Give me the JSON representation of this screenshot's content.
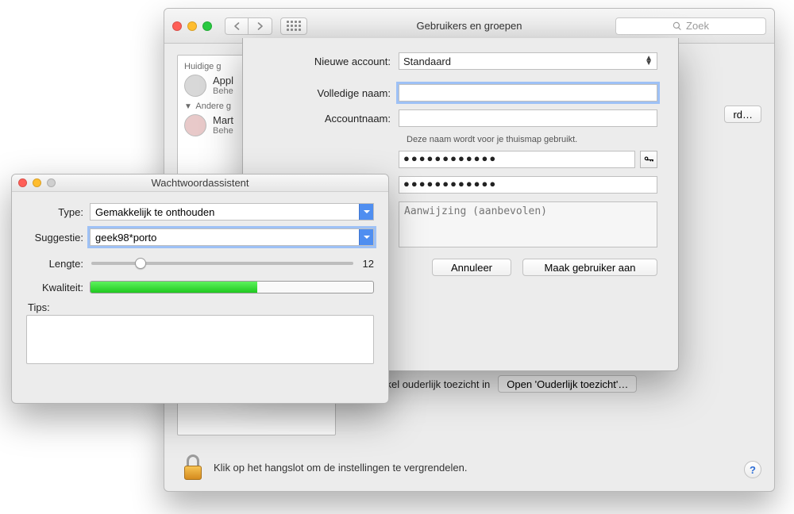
{
  "pref": {
    "title": "Gebruikers en groepen",
    "search_placeholder": "Zoek",
    "sidebar": {
      "current_header": "Huidige g",
      "current_user_name": "Appl",
      "current_user_role": "Behe",
      "other_header": "Andere g",
      "other_user_name": "Mart",
      "other_user_role": "Behe"
    },
    "change_password_btn": "rd…",
    "parental_label": "hakel ouderlijk toezicht in",
    "open_parental_btn": "Open 'Ouderlijk toezicht'…",
    "lock_text": "Klik op het hangslot om de instellingen te vergrendelen.",
    "help": "?"
  },
  "sheet": {
    "fields": {
      "new_account_label": "Nieuwe account:",
      "new_account_value": "Standaard",
      "full_name_label": "Volledige naam:",
      "full_name_value": "",
      "account_name_label": "Accountnaam:",
      "account_name_value": "",
      "account_name_hint": "Deze naam wordt voor je thuismap gebruikt.",
      "password_value": "●●●●●●●●●●●●",
      "verify_value": "●●●●●●●●●●●●",
      "hint_placeholder": "Aanwijzing (aanbevolen)"
    },
    "cancel_btn": "Annuleer",
    "create_btn": "Maak gebruiker aan"
  },
  "assistant": {
    "title": "Wachtwoordassistent",
    "type_label": "Type:",
    "type_value": "Gemakkelijk te onthouden",
    "suggestion_label": "Suggestie:",
    "suggestion_value": "geek98*porto",
    "length_label": "Lengte:",
    "length_value": "12",
    "quality_label": "Kwaliteit:",
    "quality_percent": 59,
    "tips_label": "Tips:"
  }
}
